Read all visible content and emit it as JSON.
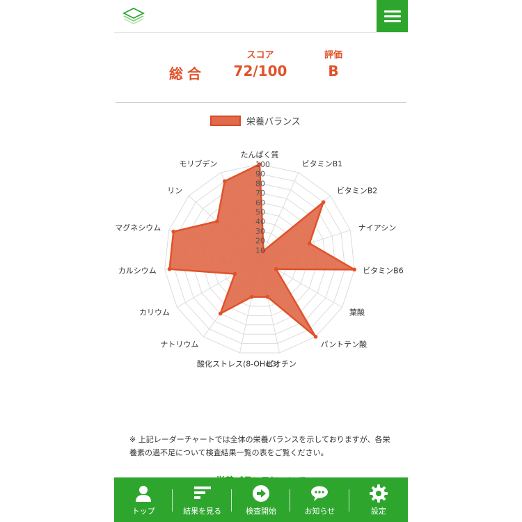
{
  "header": {
    "logo_icon": "stack-layers-icon",
    "menu_icon": "hamburger-menu-icon"
  },
  "summary": {
    "label": "総合",
    "score_heading": "スコア",
    "score_value": "72/100",
    "grade_heading": "評価",
    "grade_value": "B"
  },
  "colors": {
    "accent": "#e0522a",
    "fill": "#e06b4c",
    "green": "#2ea62e"
  },
  "chart_data": {
    "type": "radar",
    "legend": [
      "栄養バランス"
    ],
    "rlim": [
      0,
      100
    ],
    "ticks": [
      "10",
      "20",
      "30",
      "40",
      "50",
      "60",
      "70",
      "80",
      "90",
      "100"
    ],
    "categories": [
      "たんぱく質",
      "ビタミンB1",
      "ビタミンB2",
      "ナイアシン",
      "ビタミンB6",
      "葉酸",
      "パントテン酸",
      "ビオチン",
      "酸化ストレス(8-OHdG)",
      "ナトリウム",
      "カリウム",
      "カルシウム",
      "マグネシウム",
      "リン",
      "モリブデン"
    ],
    "series": [
      {
        "name": "栄養バランス",
        "values": [
          100,
          10,
          90,
          55,
          100,
          20,
          100,
          40,
          40,
          70,
          30,
          95,
          95,
          60,
          90
        ]
      }
    ]
  },
  "note": "※ 上記レーダーチャートでは全体の栄養バランスを示しておりますが、各栄養素の過不足について検査結果一覧の表をご覧ください。",
  "section_title": "栄養バランスについて",
  "tabs": [
    {
      "label": "トップ",
      "icon": "user-icon"
    },
    {
      "label": "結果を見る",
      "icon": "bar-list-icon"
    },
    {
      "label": "検査開始",
      "icon": "arrow-circle-icon"
    },
    {
      "label": "お知らせ",
      "icon": "speech-bubble-icon"
    },
    {
      "label": "設定",
      "icon": "gear-icon"
    }
  ]
}
